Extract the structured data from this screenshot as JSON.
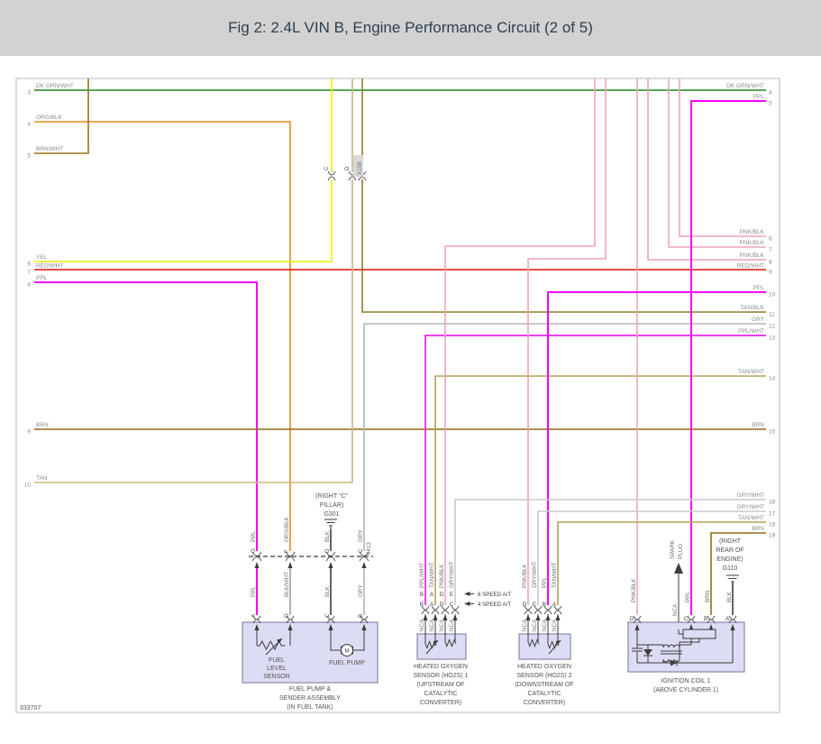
{
  "header": {
    "title": "Fig 2: 2.4L VIN B, Engine Performance Circuit (2 of 5)"
  },
  "footer": {
    "doc_number": "333707"
  },
  "colors": {
    "dk_grn_wht": "#1a8c1a",
    "org_blk": "#e8871e",
    "brn_wht": "#9a7516",
    "yel": "#f4ec00",
    "red_wht": "#e01008",
    "ppl": "#fa00fa",
    "ppl_wht": "#f23cf2",
    "pnk_blk": "#efa3b9",
    "brn": "#8f6d14",
    "tan": "#cdb582",
    "tan_wht": "#b5a057",
    "tan_blk": "#8f7d2a",
    "gry": "#b5b5b5",
    "gry_wht": "#c8c8c8",
    "blk": "#3c3c3c",
    "blk_wht": "#9c9c9c",
    "frame": "#b9b9b9",
    "box_fill": "#dcdcf4",
    "box_stroke": "#8888aa",
    "titlebar": "#d2d2d2",
    "title_text": "#2e3e4e"
  },
  "left_rail": [
    {
      "num": "3",
      "label": "DK GRN/WHT"
    },
    {
      "num": "4",
      "label": "ORG/BLK"
    },
    {
      "num": "5",
      "label": "BRN/WHT"
    },
    {
      "num": "6",
      "label": "YEL"
    },
    {
      "num": "7",
      "label": "RED/WHT"
    },
    {
      "num": "8",
      "label": "PPL"
    },
    {
      "num": "9",
      "label": "BRN"
    },
    {
      "num": "10",
      "label": "TAN"
    }
  ],
  "right_rail": [
    {
      "num": "4",
      "label": "DK GRN/WHT"
    },
    {
      "num": "5",
      "label": "PPL"
    },
    {
      "num": "6",
      "label": "PNK/BLK"
    },
    {
      "num": "7",
      "label": "PNK/BLK"
    },
    {
      "num": "8",
      "label": "PNK/BLK"
    },
    {
      "num": "9",
      "label": "RED/WHT"
    },
    {
      "num": "10",
      "label": "PPL"
    },
    {
      "num": "11",
      "label": "TAN/BLK"
    },
    {
      "num": "12",
      "label": "GRY"
    },
    {
      "num": "13",
      "label": "PPL/WHT"
    },
    {
      "num": "14",
      "label": "TAN/WHT"
    },
    {
      "num": "15",
      "label": "BRN"
    },
    {
      "num": "16",
      "label": "GRY/WHT"
    },
    {
      "num": "17",
      "label": "GRY/WHT"
    },
    {
      "num": "18",
      "label": "TAN/WHT"
    },
    {
      "num": "19",
      "label": "BRN"
    }
  ],
  "x108": {
    "name": "X108",
    "pin_yel": "C",
    "pin_tan": "D"
  },
  "x413": {
    "name": "X413",
    "above": [
      {
        "pin": "G",
        "wire": "PPL"
      },
      {
        "pin": "F",
        "wire": "ORG/BLK"
      },
      {
        "pin": "D",
        "wire": "BLK"
      },
      {
        "pin": "C",
        "wire": "GRY"
      }
    ],
    "below": [
      {
        "pin": "A",
        "wire": "PPL"
      },
      {
        "pin": "D",
        "wire": "BLK/WHT"
      },
      {
        "pin": "C",
        "wire": "BLK"
      },
      {
        "pin": "B",
        "wire": "GRY"
      }
    ]
  },
  "g301": {
    "line1": "(RIGHT \"C\"",
    "line2": "PILLAR)",
    "name": "G301"
  },
  "g110": {
    "line1": "(RIGHT",
    "line2": "REAR OF",
    "line3": "ENGINE)",
    "name": "G110"
  },
  "fuel_pump": {
    "sensor_label": [
      "FUEL",
      "LEVEL",
      "SENSOR"
    ],
    "motor_letter": "M",
    "pump_label": "FUEL PUMP",
    "caption": [
      "FUEL PUMP &",
      "SENDER ASSEMBLY",
      "(IN FUEL TANK)"
    ]
  },
  "ho2s1": {
    "wires": [
      "PPL/WHT",
      "TAN/WHT",
      "PNK/BLK",
      "GRY/WHT"
    ],
    "nca": "NCA",
    "pins_row1": [
      "B",
      "A",
      "D",
      "E"
    ],
    "pins_row2": [
      "B",
      "A",
      "D",
      "C"
    ],
    "note1": "6 SPEED A/T",
    "note2": "4 SPEED A/T",
    "caption": [
      "HEATED OXYGEN",
      "SENSOR (HO2S) 1",
      "(UPSTREAM OF",
      "CATALYTIC",
      "CONVERTER)"
    ]
  },
  "ho2s2": {
    "wires": [
      "PNK/BLK",
      "GRY/WHT",
      "PPL",
      "TAN/WHT"
    ],
    "nca": "NCA",
    "pins": [
      "D",
      "E",
      "B",
      "A"
    ],
    "caption": [
      "HEATED OXYGEN",
      "SENSOR (HO2S) 2",
      "(DOWNSTREAM OF",
      "CATALYTIC",
      "CONVERTER)"
    ]
  },
  "coil": {
    "wire_d": "PNK/BLK",
    "wire_c": "PPL",
    "wire_b": "BRN",
    "wire_a": "BLK",
    "nca": "NCA",
    "spark": [
      "SPARK",
      "PLUG"
    ],
    "pins": [
      "D",
      "C",
      "B",
      "A"
    ],
    "caption": [
      "IGNITION COIL 1",
      "(ABOVE CYLINDER 1)"
    ]
  }
}
